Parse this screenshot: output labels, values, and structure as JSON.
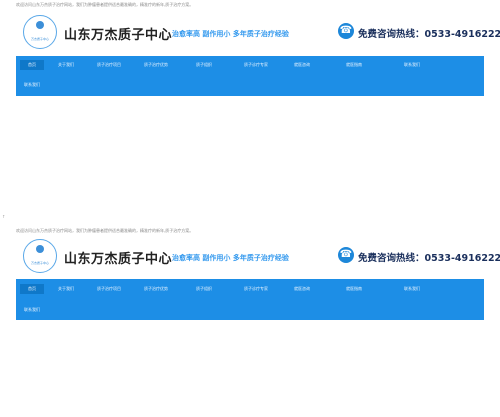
{
  "header": {
    "welcome_text": "欢迎访问山东万杰质子治疗网站，我们为肿瘤患者提供适合最准确的，精准疗的新年,质子治疗方案。",
    "logo_text": "万杰质子中心",
    "site_name": "山东万杰质子中心",
    "slogan": "治愈率高  副作用小  多年质子治疗经验",
    "hotline_label": "免费咨询热线：",
    "hotline_number": "0533-4916222",
    "phone_icon": "phone-icon"
  },
  "nav": {
    "items": [
      {
        "label": "首页"
      },
      {
        "label": "关于我们"
      },
      {
        "label": "质子治疗项目"
      },
      {
        "label": "质子治疗优势"
      },
      {
        "label": "质子组织"
      },
      {
        "label": "质子诊疗专家"
      },
      {
        "label": "就医咨询"
      },
      {
        "label": "就医指南"
      },
      {
        "label": "联系我们"
      },
      {
        "label": "联系我们"
      }
    ]
  },
  "side_mark": "↑",
  "colors": {
    "nav_bg": "#1d8ee6",
    "nav_active": "#0f78c9",
    "brand_blue": "#1d87d9",
    "slogan": "#3399ee"
  }
}
